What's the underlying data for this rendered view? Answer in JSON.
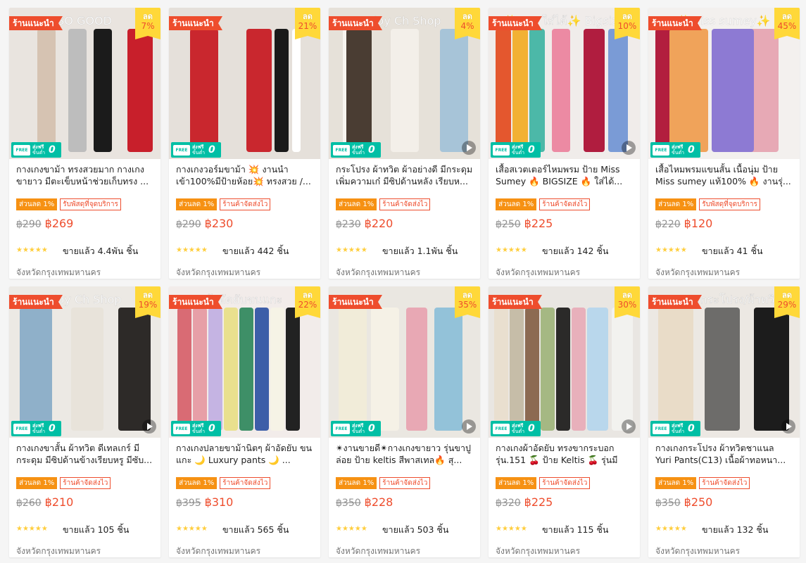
{
  "common": {
    "recommended_badge": "ร้านแนะนำ",
    "discount_label": "ลด",
    "free_ship_line1": "ส่งฟรี",
    "free_ship_line2": "ขั้นต่ำ",
    "free_ship_logo": "0",
    "free_ship_truck": "FREE",
    "chip_discount": "ส่วนลด 1%",
    "stars": "★★★★★",
    "location": "จังหวัดกรุงเทพมหานคร"
  },
  "products": [
    {
      "title": "กางเกงขาม้า ทรงสวยมาก กางเกงขายาว มีตะเข็บหน้าช่วยเก็บทรง ...",
      "discount": "7%",
      "chip_service": "รับพัสดุที่จุดบริการ",
      "old_price": "฿290",
      "price": "฿269",
      "sold": "ขายแล้ว 4.4พัน ชิ้น",
      "has_video": false,
      "overlay_text": "SO GOOD"
    },
    {
      "title": "กางเกงวอร์มขาม้า 💥 งานนำเข้า100%มีป้ายห้อย💥 ทรงสวย /...",
      "discount": "21%",
      "chip_service": "ร้านค้าจัดส่งไว",
      "old_price": "฿290",
      "price": "฿230",
      "sold": "ขายแล้ว 442 ชิ้น",
      "has_video": false,
      "overlay_text": ""
    },
    {
      "title": "กระโปรง ผ้าทวิต ผ้าอย่างดี มีกระดุมเพิ่มความเก๋ มีซิปด้านหลัง เรียบห...",
      "discount": "4%",
      "chip_service": "ร้านค้าจัดส่งไว",
      "old_price": "฿230",
      "price": "฿220",
      "sold": "ขายแล้ว 1.1พัน ชิ้น",
      "has_video": true,
      "overlay_text": "Ploy Ch Shop"
    },
    {
      "title": "เสื้อสเวตเตอร์ไหมพรม ป้าย Miss Sumey 🔥 BIGSIZE 🔥 ใส่ได้...",
      "discount": "10%",
      "chip_service": "ร้านค้าจัดส่งไว",
      "old_price": "฿250",
      "price": "฿225",
      "sold": "ขายแล้ว 142 ชิ้น",
      "has_video": true,
      "overlay_text": "✨ช/ญ ใส่ได้✨ Bigsize"
    },
    {
      "title": "เสื้อไหมพรมแขนสั้น เนื้อนุ่ม ป้าย Miss sumey แท้100% 🔥 งานรุ่...",
      "discount": "45%",
      "chip_service": "รับพัสดุที่จุดบริการ",
      "old_price": "฿220",
      "price": "฿120",
      "sold": "ขายแล้ว 41 ชิ้น",
      "has_video": false,
      "overlay_text": "✨Miss sumey✨"
    },
    {
      "title": "กางเกงขาสั้น ผ้าทวิต ดีเทลเกร์ มีกระดุม มีซิปด้านข้างเรียบหรู มีซับ...",
      "discount": "19%",
      "chip_service": "ร้านค้าจัดส่งไว",
      "old_price": "฿260",
      "price": "฿210",
      "sold": "ขายแล้ว 105 ชิ้น",
      "has_video": true,
      "overlay_text": "Ploy Ch Shop"
    },
    {
      "title": "กางเกงปลายขาม้านิตๆ ผ้าอัดยับ ขนแกะ 🌙 Luxury pants 🌙 ...",
      "discount": "22%",
      "chip_service": "ร้านค้าจัดส่งไว",
      "old_price": "฿395",
      "price": "฿310",
      "sold": "ขายแล้ว 565 ชิ้น",
      "has_video": false,
      "overlay_text": "ผ้าอัดยับขนแกะ"
    },
    {
      "title": "✴งานขายดี✴กางเกงขายาว รุ่นขาปูล่อย ป้าย keltis สีพาสเทล🔥 สุ...",
      "discount": "35%",
      "chip_service": "ร้านค้าจัดส่งไว",
      "old_price": "฿350",
      "price": "฿228",
      "sold": "ขายแล้ว 503 ชิ้น",
      "has_video": true,
      "overlay_text": ""
    },
    {
      "title": "กางเกงผ้าอัดยับ ทรงขากระบอก รุ่น.151 🍒 ป้าย Keltis 🍒 รุ่นมีเชือ...",
      "discount": "30%",
      "chip_service": "ร้านค้าจัดส่งไว",
      "old_price": "฿320",
      "price": "฿225",
      "sold": "ขายแล้ว 115 ชิ้น",
      "has_video": true,
      "overlay_text": ""
    },
    {
      "title": "กางเกงกระโปรง ผ้าทวิตชาแนล Yuri Pants(C13) เนื้อผ้าทอหนา...",
      "discount": "29%",
      "chip_service": "ร้านค้าจัดส่งไว",
      "old_price": "฿350",
      "price": "฿250",
      "sold": "ขายแล้ว 132 ชิ้น",
      "has_video": true,
      "overlay_text": "กางเกงกระโปรง/ผ้าทวิต"
    }
  ],
  "colors": {
    "brand": "#ee4d2d",
    "discount_tag": "#ffd839",
    "free_ship": "#00bfa5",
    "chip_discount": "#f69113",
    "stars": "#ffce3d"
  }
}
